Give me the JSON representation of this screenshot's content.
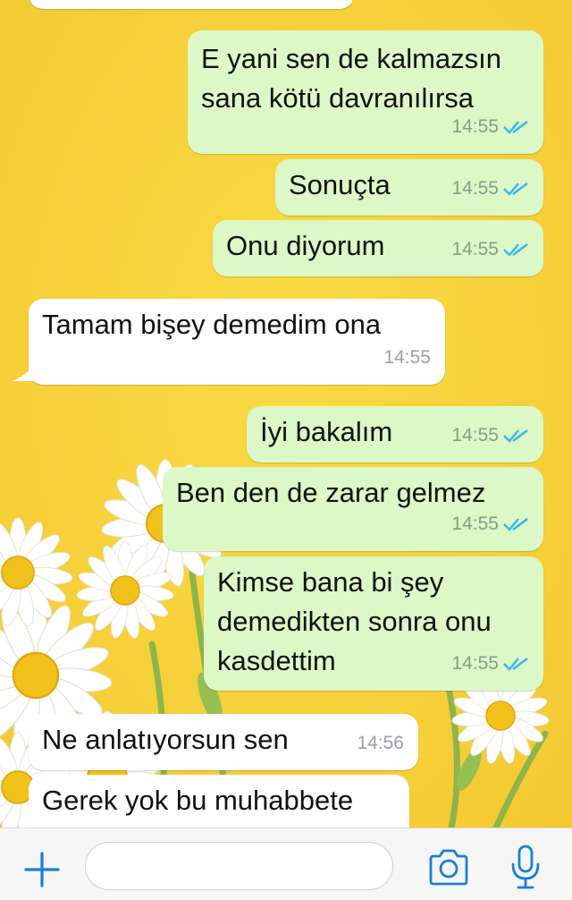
{
  "colors": {
    "outgoing_bubble": "#dcf8c6",
    "incoming_bubble": "#ffffff",
    "read_ticks": "#34b7f1",
    "accent": "#1a7ed6",
    "wallpaper": "#f8d33b"
  },
  "messages": [
    {
      "direction": "outgoing",
      "text": "E yani sen de kalmazsın\nsana kötü davranılırsa",
      "time": "14:55",
      "status": "read"
    },
    {
      "direction": "outgoing",
      "text": "Sonuçta",
      "time": "14:55",
      "status": "read"
    },
    {
      "direction": "outgoing",
      "text": "Onu diyorum",
      "time": "14:55",
      "status": "read"
    },
    {
      "direction": "incoming",
      "text": "Tamam bişey demedim ona",
      "time": "14:55"
    },
    {
      "direction": "outgoing",
      "text": "İyi bakalım",
      "time": "14:55",
      "status": "read"
    },
    {
      "direction": "outgoing",
      "text": "Ben den de zarar gelmez",
      "time": "14:55",
      "status": "read"
    },
    {
      "direction": "outgoing",
      "text": "Kimse bana bi şey\ndemedikten sonra onu\nkasdettim",
      "time": "14:55",
      "status": "read"
    },
    {
      "direction": "incoming",
      "text": "Ne anlatıyorsun sen",
      "time": "14:56"
    },
    {
      "direction": "incoming",
      "text": "Gerek yok bu muhabbete",
      "time": ""
    }
  ],
  "input_bar": {
    "placeholder": "",
    "icons": [
      "plus-icon",
      "camera-icon",
      "microphone-icon"
    ]
  }
}
